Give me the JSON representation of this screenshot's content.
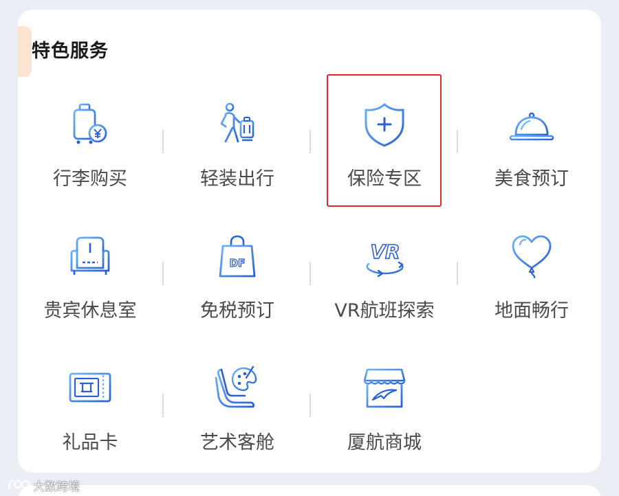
{
  "section": {
    "title": "特色服务"
  },
  "services": [
    {
      "label": "行李购买",
      "icon": "luggage-yen-icon"
    },
    {
      "label": "轻装出行",
      "icon": "traveler-luggage-icon"
    },
    {
      "label": "保险专区",
      "icon": "shield-plus-icon"
    },
    {
      "label": "美食预订",
      "icon": "food-cloche-icon"
    },
    {
      "label": "贵宾休息室",
      "icon": "armchair-icon"
    },
    {
      "label": "免税预订",
      "icon": "duty-free-bag-icon"
    },
    {
      "label": "VR航班探索",
      "icon": "vr-rotate-icon"
    },
    {
      "label": "地面畅行",
      "icon": "heart-balloon-icon"
    },
    {
      "label": "礼品卡",
      "icon": "gift-card-icon"
    },
    {
      "label": "艺术客舱",
      "icon": "seat-palette-icon"
    },
    {
      "label": "厦航商城",
      "icon": "airline-store-icon"
    }
  ],
  "highlighted_item": "保险专区",
  "watermark": {
    "text": "大数跨境"
  },
  "colors": {
    "icon_blue": "#2f6fe0",
    "icon_light_blue": "#5aa7ff",
    "highlight_red": "#e0262b",
    "accent_peach": "#fde3d2"
  }
}
